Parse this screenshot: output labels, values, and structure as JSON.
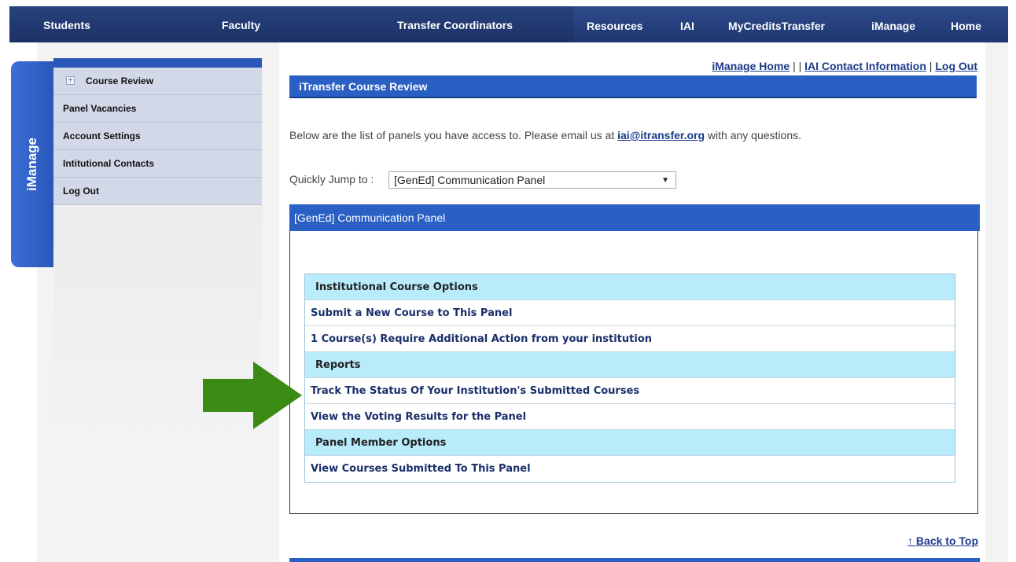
{
  "topnav": {
    "items": [
      "Students",
      "Faculty",
      "Transfer Coordinators",
      "Resources",
      "IAI",
      "MyCreditsTransfer",
      "iManage",
      "Home"
    ]
  },
  "side_tab": {
    "label": "iManage"
  },
  "sidebar": {
    "items": [
      "Course Review",
      "Panel Vacancies",
      "Account Settings",
      "Intitutional Contacts",
      "Log Out"
    ]
  },
  "toplinks": {
    "imanage_home": "iManage Home",
    "sep1": " | | ",
    "iai_contact": "IAI Contact Information",
    "sep2": " | ",
    "logout": "Log Out"
  },
  "page": {
    "title": "iTransfer Course Review",
    "intro_before": "Below are the list of panels you have access to. Please email us at ",
    "email": "iai@itransfer.org",
    "intro_after": " with any questions.",
    "jump_label": "Quickly Jump to : ",
    "jump_selected": "[GenEd] Communication Panel",
    "panel_title": "[GenEd] Communication Panel"
  },
  "options": [
    {
      "text": "Institutional Course Options",
      "type": "header"
    },
    {
      "text": "Submit a New Course to This Panel",
      "type": "link"
    },
    {
      "text": "1 Course(s) Require Additional Action from your institution",
      "type": "link"
    },
    {
      "text": "Reports",
      "type": "header"
    },
    {
      "text": "Track The Status Of Your Institution's Submitted Courses",
      "type": "link"
    },
    {
      "text": "View the Voting Results for the Panel",
      "type": "link"
    },
    {
      "text": "Panel Member Options",
      "type": "header"
    },
    {
      "text": "View Courses Submitted To This Panel",
      "type": "link"
    }
  ],
  "footer": {
    "back_to_top": "↑ Back to Top"
  },
  "colors": {
    "nav_bg": "#1c3266",
    "accent_blue": "#2a5fc4",
    "header_row_bg": "#b9ecfb",
    "arrow_green": "#3a8a14"
  },
  "icons": {
    "expand": "plus-box-icon",
    "callout": "green-arrow-icon",
    "dropdown": "triangle-down-icon"
  }
}
